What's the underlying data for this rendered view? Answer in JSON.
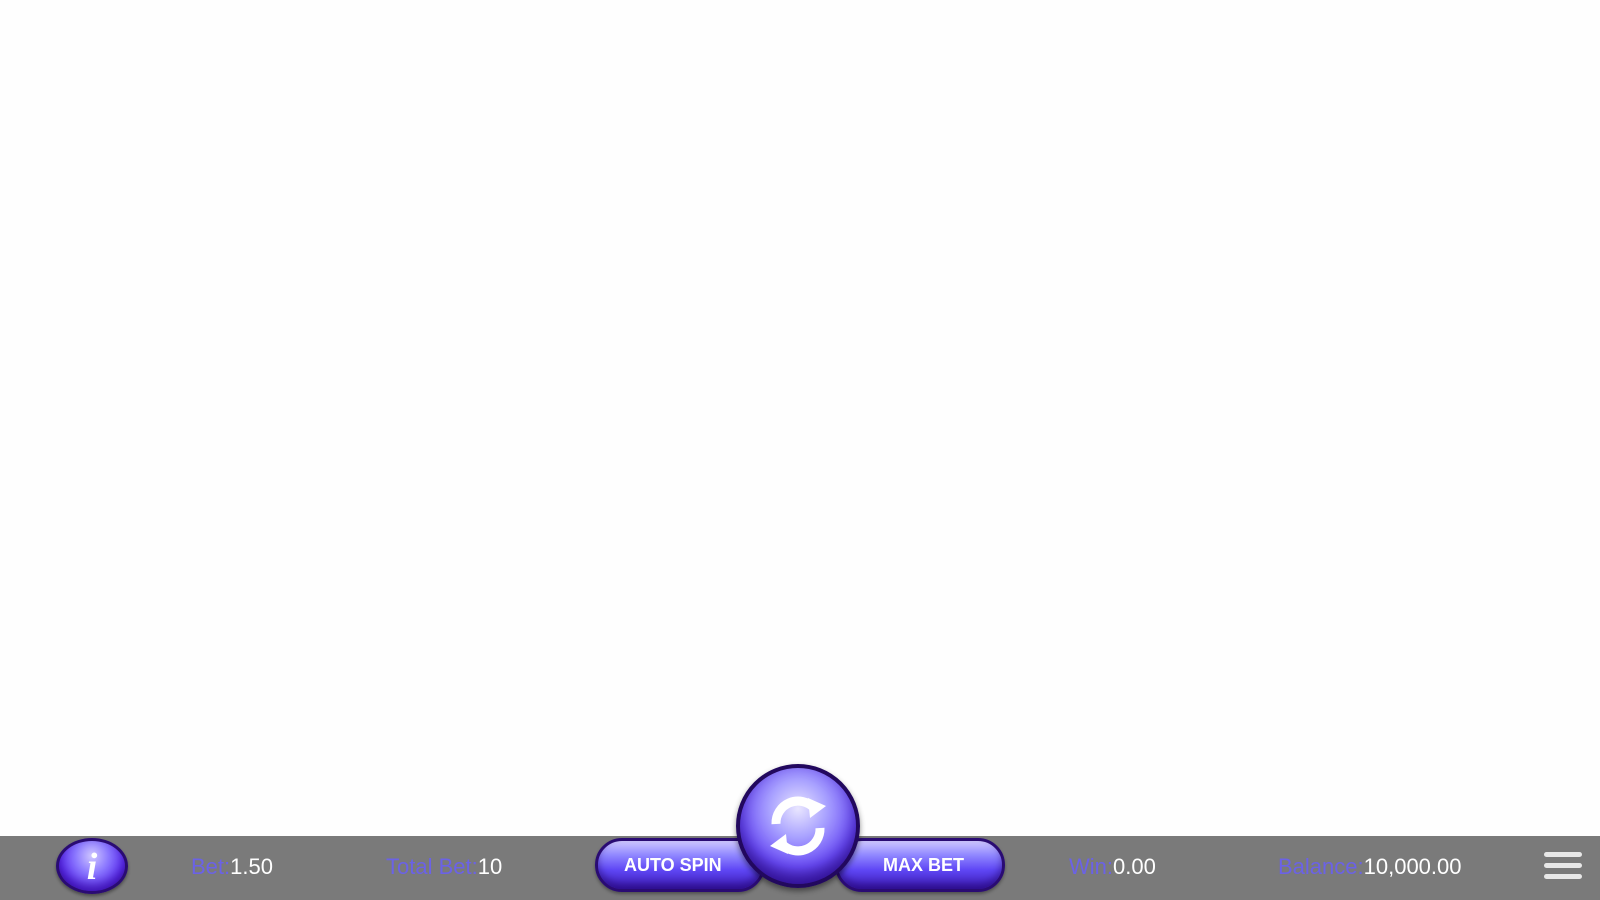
{
  "bar": {
    "bet": {
      "label": "Bet:",
      "value": "1.50"
    },
    "total_bet": {
      "label": "Total Bet:",
      "value": "10"
    },
    "win": {
      "label": "Win:",
      "value": "0.00"
    },
    "balance": {
      "label": "Balance:",
      "value": "10,000.00"
    }
  },
  "buttons": {
    "info": {
      "glyph": "i",
      "icon": "info-icon"
    },
    "auto_spin": {
      "label": "AUTO SPIN"
    },
    "max_bet": {
      "label": "MAX BET"
    },
    "spin": {
      "icon": "refresh-arrows-icon"
    },
    "menu": {
      "icon": "hamburger-menu-icon"
    }
  },
  "colors": {
    "bar_background": "#7a7a7a",
    "label_accent": "#6b62e6",
    "button_purple": "#5f47f5"
  }
}
